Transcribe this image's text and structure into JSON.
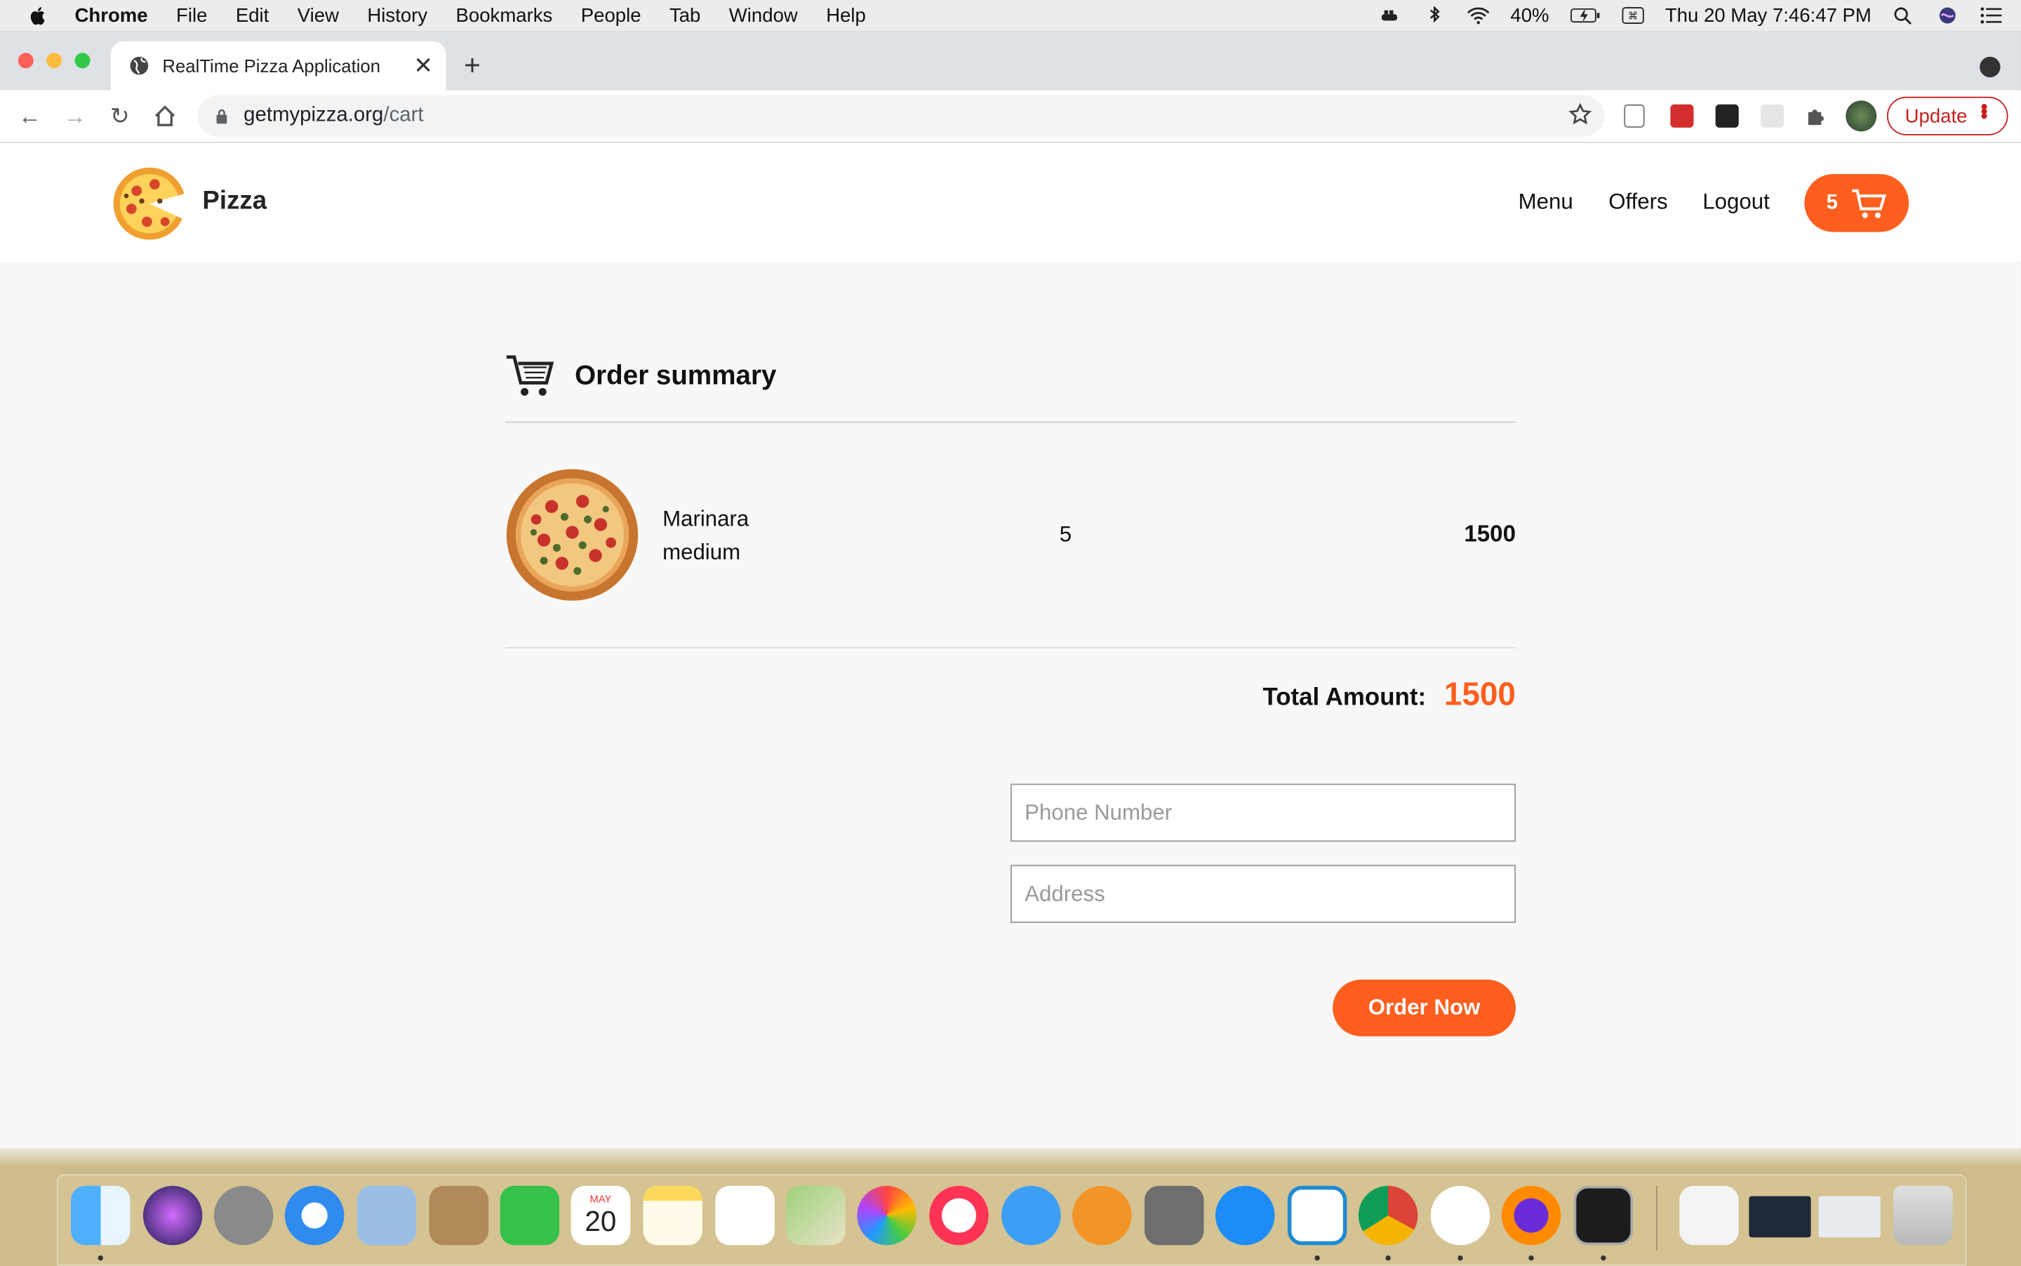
{
  "menubar": {
    "app_name": "Chrome",
    "menus": [
      "File",
      "Edit",
      "View",
      "History",
      "Bookmarks",
      "People",
      "Tab",
      "Window",
      "Help"
    ],
    "battery": "40%",
    "datetime": "Thu 20 May  7:46:47 PM"
  },
  "browser": {
    "tab_title": "RealTime Pizza Application",
    "url_host": "getmypizza.org",
    "url_path": "/cart",
    "update_label": "Update"
  },
  "site": {
    "brand": "Pizza",
    "nav": [
      "Menu",
      "Offers",
      "Logout"
    ],
    "cart_count": "5"
  },
  "summary": {
    "title": "Order summary",
    "items": [
      {
        "name": "Marinara",
        "size": "medium",
        "qty": "5",
        "price": "1500"
      }
    ],
    "total_label": "Total Amount:",
    "total_value": "1500",
    "phone_placeholder": "Phone Number",
    "address_placeholder": "Address",
    "order_button": "Order Now"
  },
  "colors": {
    "accent": "#fe5f1e",
    "page_bg": "#f8f8f8"
  },
  "dock_icons": [
    "finder-icon",
    "siri-icon",
    "launchpad-icon",
    "safari-icon",
    "mail-icon",
    "contacts-icon",
    "facetime-icon",
    "calendar-icon",
    "notes-icon",
    "reminders-icon",
    "maps-icon",
    "photos-icon",
    "itunes-icon",
    "messages-icon",
    "books-icon",
    "system-preferences-icon",
    "app-store-icon",
    "vscode-icon",
    "chrome-icon",
    "mongodb-compass-icon",
    "firefox-icon",
    "terminal-icon",
    "json-file-icon",
    "window-preview-icon",
    "window-preview-icon-2",
    "trash-icon"
  ],
  "calendar": {
    "month": "MAY",
    "day": "20"
  }
}
